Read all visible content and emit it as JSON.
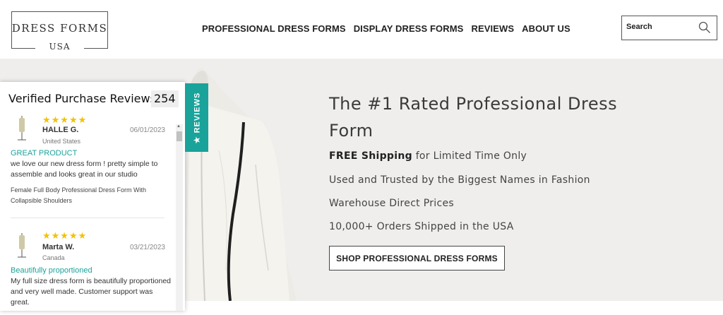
{
  "header": {
    "logo_top": "DRESS FORMS",
    "logo_bottom": "USA",
    "nav": [
      "PROFESSIONAL DRESS FORMS",
      "DISPLAY DRESS FORMS",
      "REVIEWS",
      "ABOUT US"
    ],
    "search_placeholder": "Search",
    "search_icon": "search-icon"
  },
  "hero": {
    "title": "The #1 Rated Professional Dress Form",
    "shipping_bold": "FREE Shipping",
    "shipping_rest": " for Limited Time Only",
    "line2": "Used and Trusted by the Biggest Names in Fashion",
    "line3": "Warehouse Direct Prices",
    "line4": "10,000+ Orders Shipped in the USA",
    "cta": "SHOP PROFESSIONAL DRESS FORMS"
  },
  "reviews_widget": {
    "title": "Verified Purchase Reviews",
    "count": "254",
    "tab_label": "★ REVIEWS",
    "stars": "★★★★★",
    "star_color": "#f2c200",
    "accent_color": "#1aa39a",
    "reviews": [
      {
        "name": "HALLE G.",
        "date": "06/01/2023",
        "country": "United States",
        "title": "GREAT PRODUCT",
        "body": "we love our new dress form ! pretty simple to assemble and looks great in our studio",
        "product": "Female Full Body Professional Dress Form With Collapsible Shoulders"
      },
      {
        "name": "Marta W.",
        "date": "03/21/2023",
        "country": "Canada",
        "title": "Beautifully proportioned",
        "body": "My full size dress form is beautifully proportioned and very well made. Customer support was great."
      }
    ]
  }
}
